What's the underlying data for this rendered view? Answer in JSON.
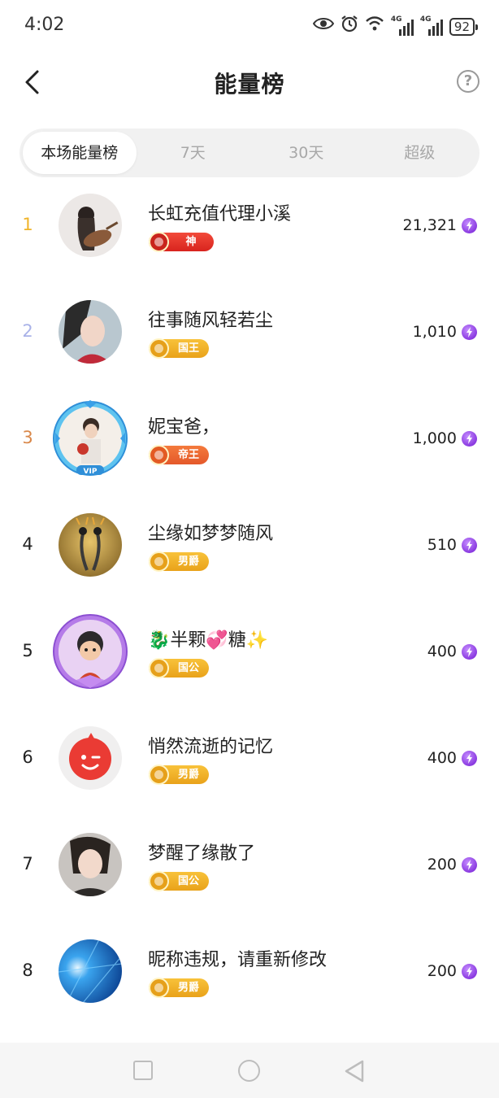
{
  "status_bar": {
    "time": "4:02",
    "net1": "4G",
    "net2": "4G",
    "battery": "92"
  },
  "header": {
    "title": "能量榜",
    "help": "?"
  },
  "tabs": [
    {
      "label": "本场能量榜",
      "active": true
    },
    {
      "label": "7天",
      "active": false
    },
    {
      "label": "30天",
      "active": false
    },
    {
      "label": "超级",
      "active": false
    }
  ],
  "ranking": [
    {
      "rank": "1",
      "name": "长虹充值代理小溪",
      "badge": "神",
      "badge_style": "red",
      "score": "21,321",
      "rank_color": "#f0b429"
    },
    {
      "rank": "2",
      "name": "往事随风轻若尘",
      "badge": "国王",
      "badge_style": "gold",
      "score": "1,010",
      "rank_color": "#a9b2e8"
    },
    {
      "rank": "3",
      "name": "妮宝爸，",
      "badge": "帝王",
      "badge_style": "orange",
      "score": "1,000",
      "rank_color": "#d9884a"
    },
    {
      "rank": "4",
      "name": "尘缘如梦梦随风",
      "badge": "男爵",
      "badge_style": "gold",
      "score": "510",
      "rank_color": "#222222"
    },
    {
      "rank": "5",
      "name": "🐉半颗💞糖✨",
      "badge": "国公",
      "badge_style": "gold",
      "score": "400",
      "rank_color": "#222222"
    },
    {
      "rank": "6",
      "name": "悄然流逝的记忆",
      "badge": "男爵",
      "badge_style": "gold",
      "score": "400",
      "rank_color": "#222222"
    },
    {
      "rank": "7",
      "name": "梦醒了缘散了",
      "badge": "国公",
      "badge_style": "gold",
      "score": "200",
      "rank_color": "#222222"
    },
    {
      "rank": "8",
      "name": "昵称违规，请重新修改",
      "badge": "男爵",
      "badge_style": "gold",
      "score": "200",
      "rank_color": "#222222"
    }
  ],
  "icons": {
    "back": "chevron-left-icon",
    "help": "question-circle-icon",
    "energy": "lightning-icon",
    "nav": [
      "square-icon",
      "circle-icon",
      "triangle-icon"
    ]
  }
}
